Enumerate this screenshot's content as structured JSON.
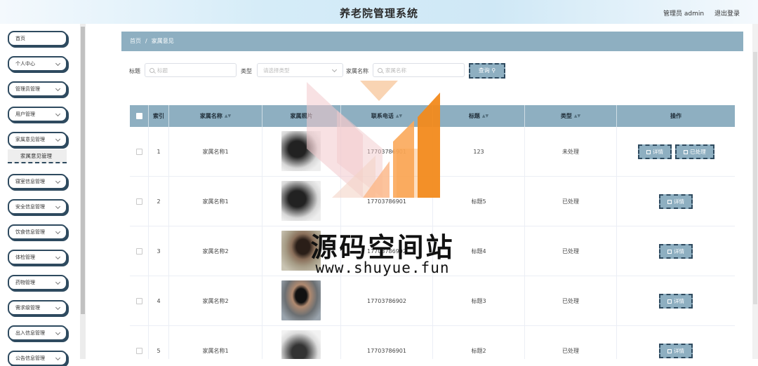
{
  "header": {
    "title": "养老院管理系统",
    "user_label": "管理员 admin",
    "logout_label": "退出登录"
  },
  "sidebar": {
    "items": [
      {
        "label": "首页"
      },
      {
        "label": "个人中心"
      },
      {
        "label": "管理员管理"
      },
      {
        "label": "用户管理"
      },
      {
        "label": "家属意见管理"
      },
      {
        "label": "寝室信息管理"
      },
      {
        "label": "安全信息管理"
      },
      {
        "label": "饮食信息管理"
      },
      {
        "label": "体检管理"
      },
      {
        "label": "药物管理"
      },
      {
        "label": "需求级管理"
      },
      {
        "label": "出入信息管理"
      },
      {
        "label": "公告信息管理"
      }
    ],
    "submenu_label": "家属意见管理"
  },
  "breadcrumb": {
    "home": "首页",
    "separator": "/",
    "current": "家属意见"
  },
  "search": {
    "title_label": "标题",
    "title_placeholder": "标题",
    "type_label": "类型",
    "type_placeholder": "请选择类型",
    "name_label": "家属名称",
    "name_placeholder": "家属名称",
    "query_label": "查询"
  },
  "table": {
    "headers": [
      "索引",
      "家属名称",
      "家属照片",
      "联系电话",
      "标题",
      "类型",
      "操作"
    ],
    "rows": [
      {
        "index": "1",
        "name": "家属名称1",
        "phone": "17703786901",
        "title": "123",
        "type": "未处理",
        "actions": [
          "详情",
          "已处理"
        ]
      },
      {
        "index": "2",
        "name": "家属名称1",
        "phone": "17703786901",
        "title": "标题5",
        "type": "已处理",
        "actions": [
          "详情"
        ]
      },
      {
        "index": "3",
        "name": "家属名称2",
        "phone": "17703786902",
        "title": "标题4",
        "type": "已处理",
        "actions": [
          "详情"
        ]
      },
      {
        "index": "4",
        "name": "家属名称2",
        "phone": "17703786902",
        "title": "标题3",
        "type": "已处理",
        "actions": [
          "详情"
        ]
      },
      {
        "index": "5",
        "name": "家属名称1",
        "phone": "17703786901",
        "title": "标题2",
        "type": "已处理",
        "actions": [
          "详情"
        ]
      }
    ]
  },
  "watermark": {
    "text": "源码空间站",
    "url": "www.shuyue.fun"
  },
  "colors": {
    "accent": "#8eafc1",
    "border_dark": "#2e4a5f",
    "logo_orange": "#f28a1c"
  }
}
